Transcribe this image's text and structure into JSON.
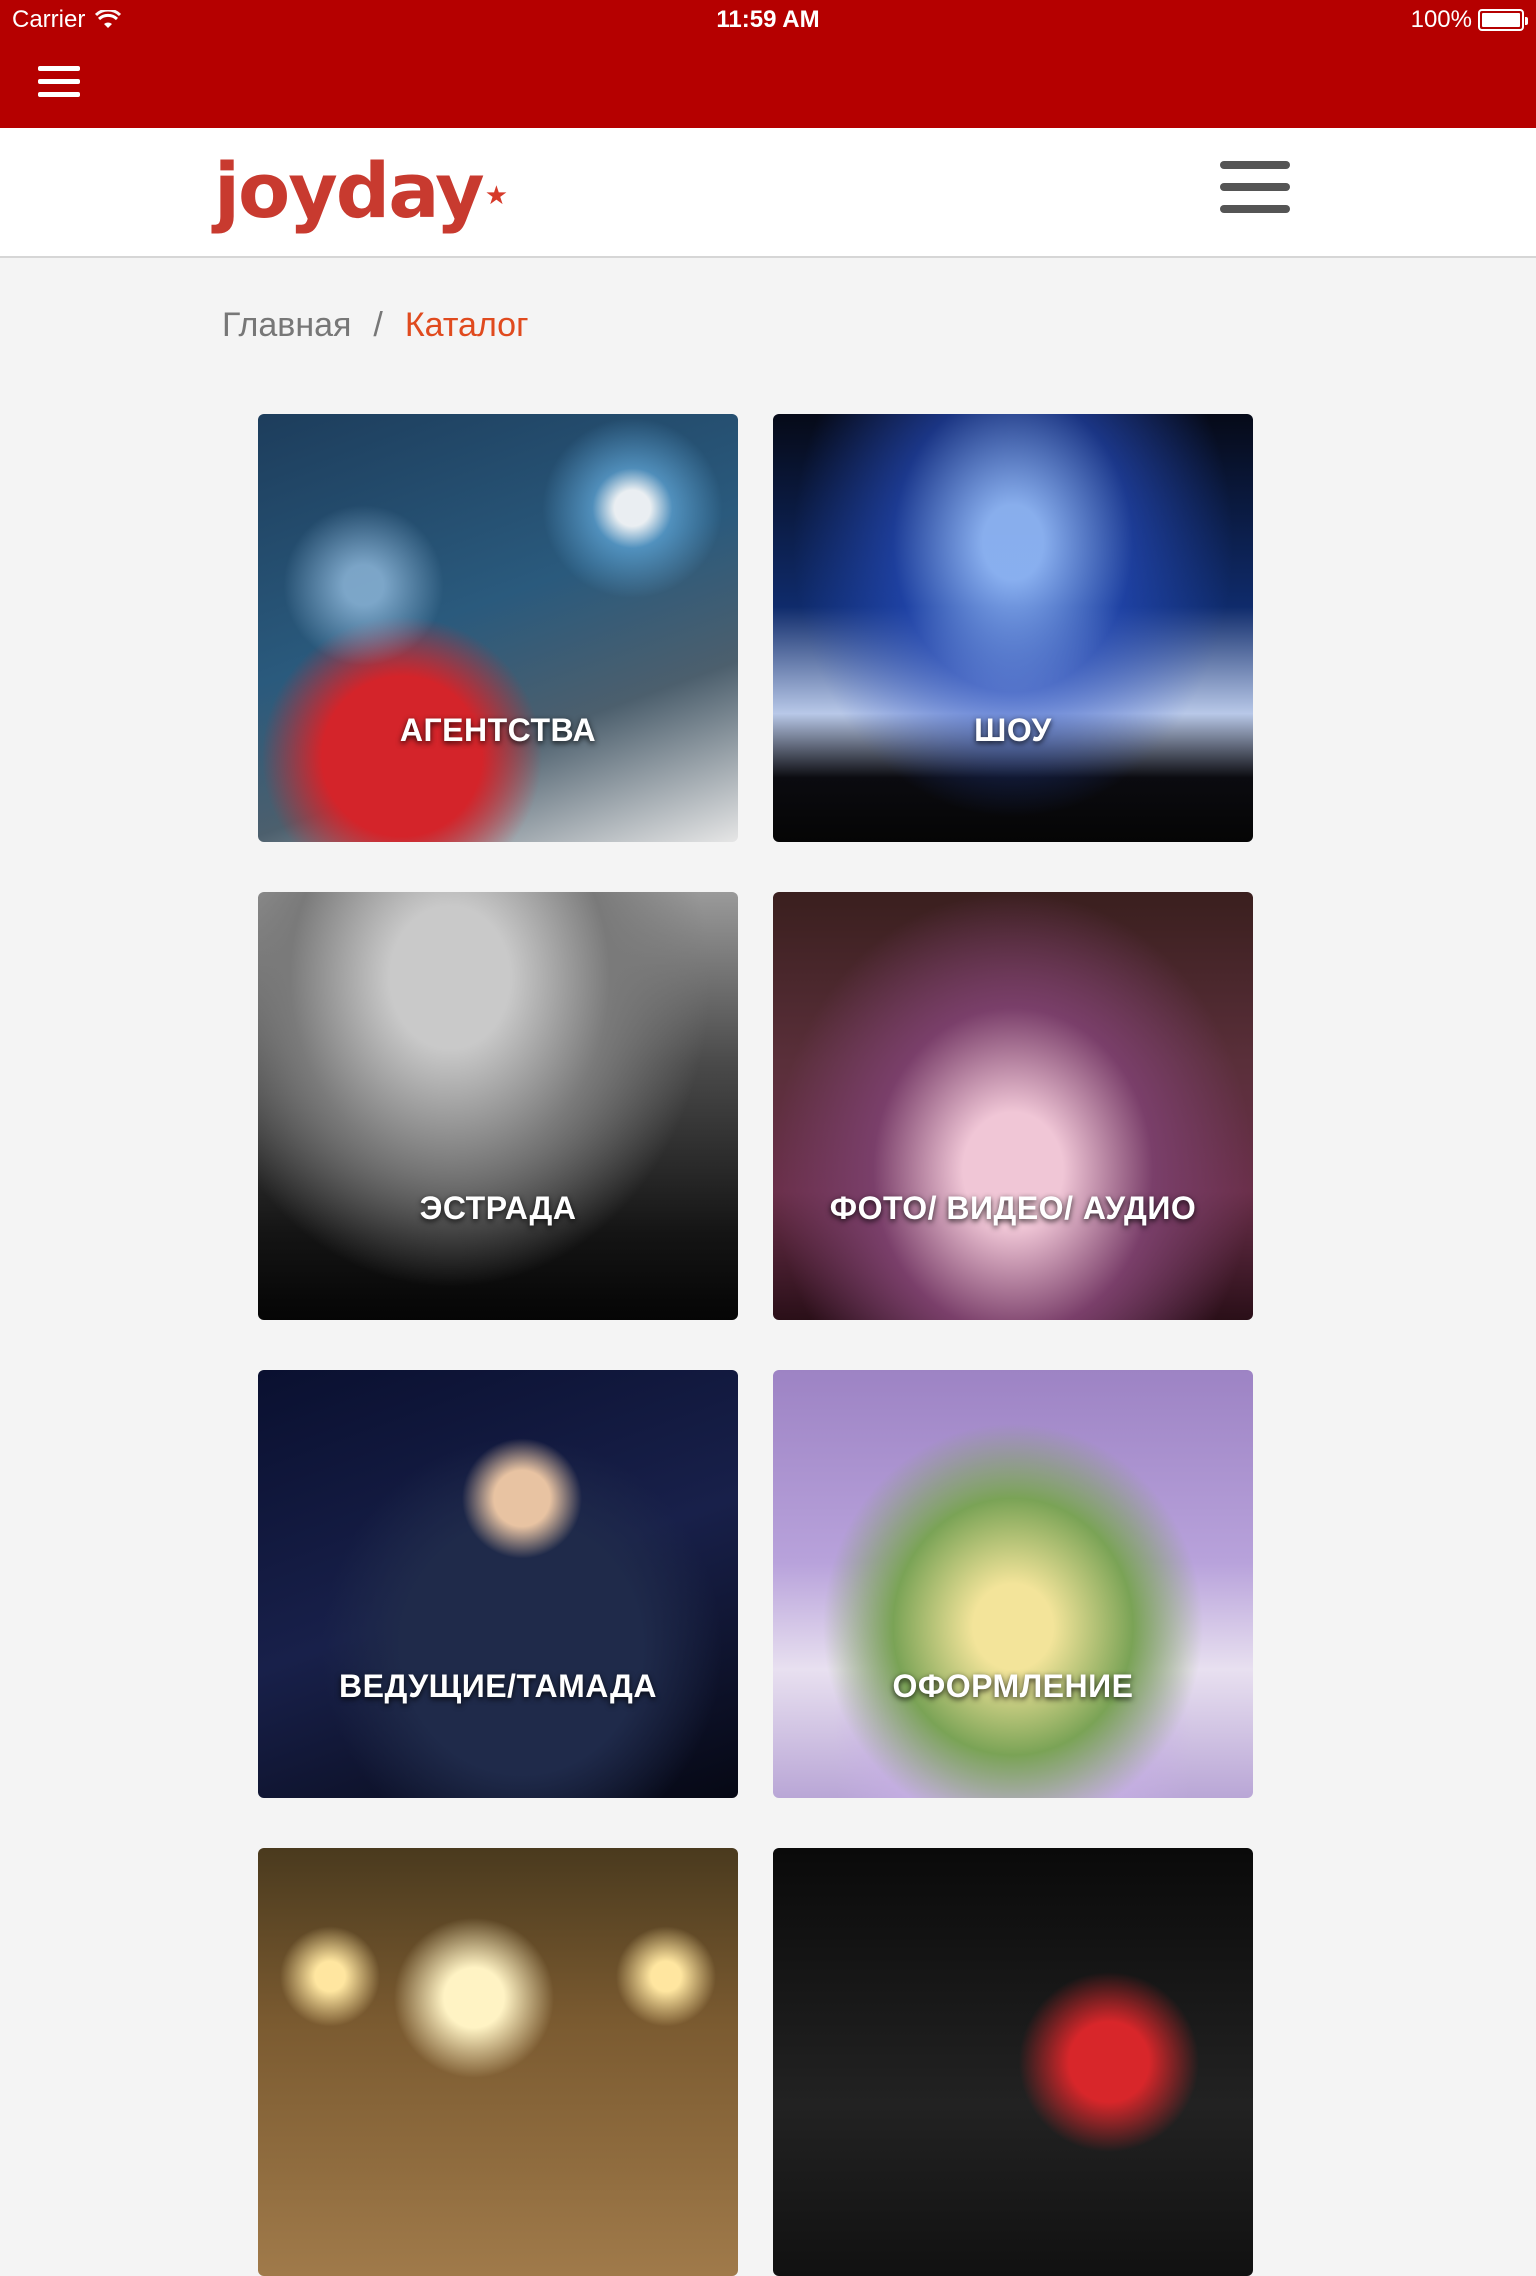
{
  "status_bar": {
    "carrier": "Carrier",
    "time": "11:59 AM",
    "battery": "100%"
  },
  "site": {
    "logo": "joyday",
    "logo_mark": "★"
  },
  "breadcrumb": {
    "home": "Главная",
    "separator": "/",
    "current": "Каталог"
  },
  "catalog": [
    {
      "label": "АГЕНТСТВА"
    },
    {
      "label": "ШОУ"
    },
    {
      "label": "ЭСТРАДА"
    },
    {
      "label": "ФОТО/ ВИДЕО/ АУДИО"
    },
    {
      "label": "ВЕДУЩИЕ/ТАМАДА"
    },
    {
      "label": "ОФОРМЛЕНИЕ"
    },
    {
      "label": ""
    },
    {
      "label": ""
    }
  ],
  "colors": {
    "app_bar": "#b50000",
    "logo": "#c83a2f",
    "breadcrumb_active": "#e04a1e"
  }
}
